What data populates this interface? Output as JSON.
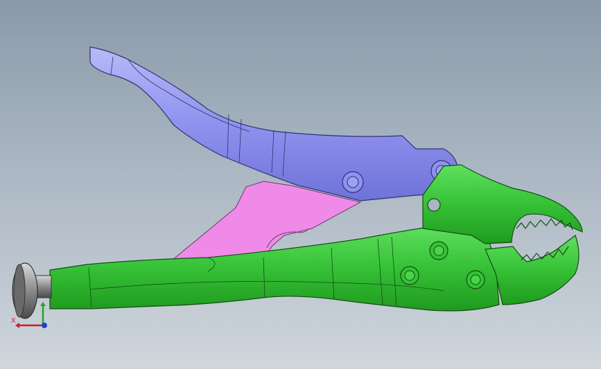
{
  "window": {},
  "model": {
    "parts": [
      {
        "id": "upper-handle",
        "color": "#8f92ee"
      },
      {
        "id": "release-lever",
        "color": "#f08ae9"
      },
      {
        "id": "lower-handle-jaw",
        "color": "#36c136"
      },
      {
        "id": "adjusting-screw-knob",
        "color": "#8c8c8c"
      }
    ]
  },
  "triad": {
    "x_label": "X",
    "x_color": "#d21c1c",
    "y_color": "#2aa02a",
    "z_color": "#1f3fd6"
  },
  "colors": {
    "viewport_top": "#8a99a9",
    "viewport_bottom": "#cfd6dc"
  }
}
